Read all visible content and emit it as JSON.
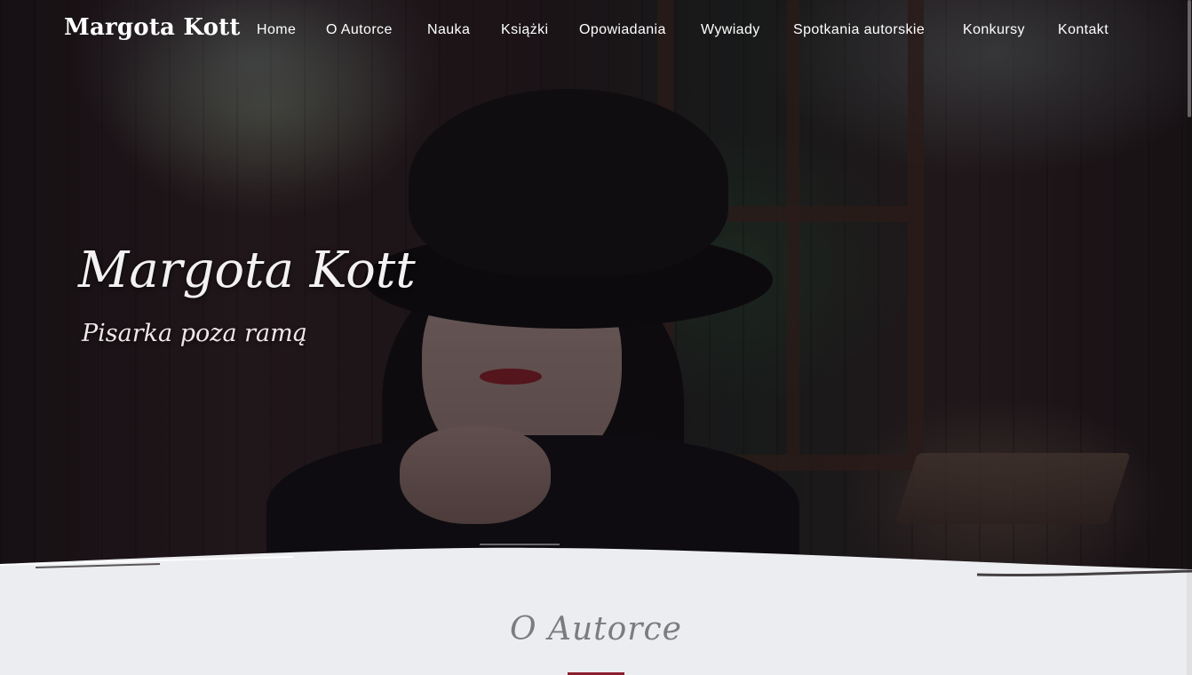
{
  "header": {
    "logo": "Margota Kott",
    "nav": [
      {
        "label": "Home"
      },
      {
        "label": "O Autorce"
      },
      {
        "label": "Nauka"
      },
      {
        "label": "Książki"
      },
      {
        "label": "Opowiadania"
      },
      {
        "label": "Wywiady"
      },
      {
        "label": "Spotkania autorskie"
      },
      {
        "label": "Konkursy"
      },
      {
        "label": "Kontakt"
      }
    ]
  },
  "hero": {
    "title": "Margota Kott",
    "subtitle": "Pisarka poza ramą"
  },
  "about": {
    "title": "O Autorce"
  },
  "colors": {
    "accent": "#8c1f2e",
    "section_background": "#ecedf0",
    "nav_text": "#ffffff"
  }
}
